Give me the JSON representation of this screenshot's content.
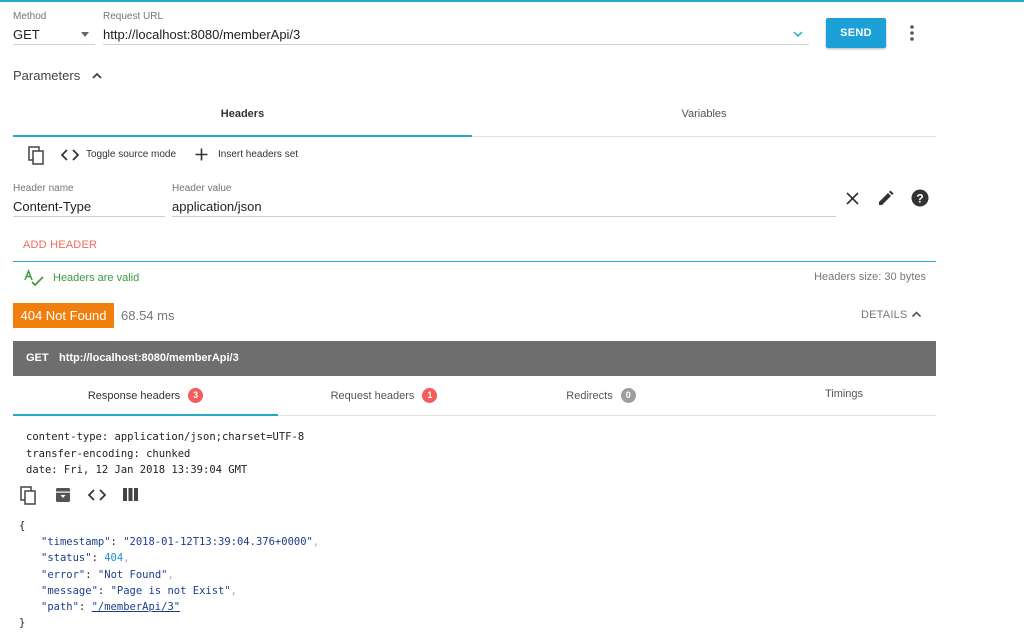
{
  "request": {
    "method_label": "Method",
    "method": "GET",
    "url_label": "Request URL",
    "url": "http://localhost:8080/memberApi/3",
    "send_label": "SEND"
  },
  "parameters": {
    "title": "Parameters",
    "tabs": [
      {
        "label": "Headers",
        "active": true
      },
      {
        "label": "Variables",
        "active": false
      }
    ],
    "toolbar": {
      "toggle_label": "Toggle source mode",
      "insert_label": "Insert headers set"
    },
    "header_row": {
      "name_label": "Header name",
      "name_value": "Content-Type",
      "value_label": "Header value",
      "value_value": "application/json"
    },
    "add_header_label": "ADD HEADER",
    "valid_label": "Headers are valid",
    "size_label": "Headers size: 30 bytes"
  },
  "response": {
    "status": "404 Not Found",
    "time": "68.54 ms",
    "details_label": "DETAILS",
    "bar_method": "GET",
    "bar_url": "http://localhost:8080/memberApi/3",
    "tabs": [
      {
        "label": "Response headers",
        "count": "3",
        "active": true
      },
      {
        "label": "Request headers",
        "count": "1",
        "active": false
      },
      {
        "label": "Redirects",
        "count": "0",
        "active": false
      },
      {
        "label": "Timings",
        "count": "",
        "active": false
      }
    ],
    "headers": [
      "content-type: application/json;charset=UTF-8",
      "transfer-encoding: chunked",
      "date: Fri, 12 Jan 2018 13:39:04 GMT"
    ],
    "body": {
      "open": "{",
      "close": "}",
      "fields": [
        {
          "key": "\"timestamp\"",
          "value": "\"2018-01-12T13:39:04.376+0000\"",
          "kind": "string"
        },
        {
          "key": "\"status\"",
          "value": "404",
          "kind": "number"
        },
        {
          "key": "\"error\"",
          "value": "\"Not Found\"",
          "kind": "string"
        },
        {
          "key": "\"message\"",
          "value": "\"Page is not Exist\"",
          "kind": "string"
        },
        {
          "key": "\"path\"",
          "value": "\"/memberApi/3\"",
          "kind": "link"
        }
      ]
    }
  },
  "colors": {
    "accent": "#26a9c8",
    "send": "#1ba0d7",
    "add_header": "#f26b5a",
    "valid": "#3d9a3d",
    "status_badge": "#f07f0e",
    "url_bar": "#6e6e6e",
    "badge_red": "#f45b5b",
    "badge_grey": "#9e9e9e"
  },
  "icons": {
    "method_dropdown": "caret-down-icon",
    "url_dropdown": "chevron-down-icon",
    "menu": "more-vert-icon",
    "params_toggle": "chevron-up-icon",
    "copy": "copy-icon",
    "code": "code-icon",
    "add": "plus-icon",
    "remove": "close-icon",
    "edit": "pencil-icon",
    "help": "help-icon",
    "valid": "spellcheck-icon",
    "details": "chevron-up-icon",
    "response_copy": "copy-icon",
    "response_archive": "archive-icon",
    "response_code": "code-icon",
    "response_columns": "columns-icon"
  }
}
